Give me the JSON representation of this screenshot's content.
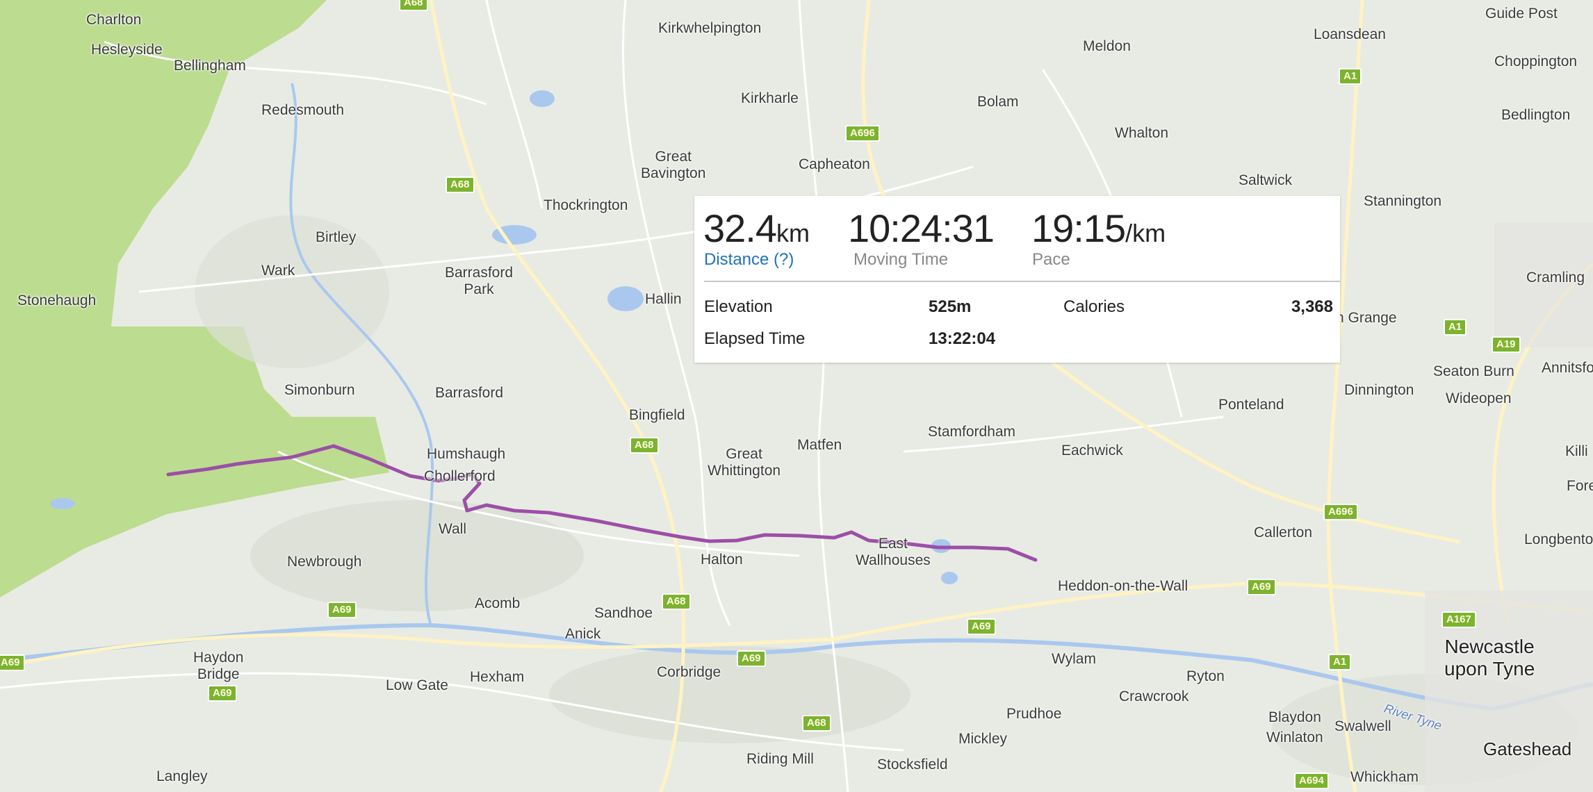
{
  "map": {
    "colors": {
      "land": "#e8ebe3",
      "forest": "#bcdc90",
      "water": "#aac8ee",
      "road": "#ffffff",
      "major_road": "#fde89a",
      "route": "#9b4fa8",
      "shield": "#7cb32f"
    },
    "places": {
      "charlton": "Charlton",
      "hesleyside": "Hesleyside",
      "bellingham": "Bellingham",
      "redesmouth": "Redesmouth",
      "birtley": "Birtley",
      "wark": "Wark",
      "stonehaugh": "Stonehaugh",
      "barrasford_park": "Barrasford\nPark",
      "simonburn": "Simonburn",
      "barrasford": "Barrasford",
      "humshaugh": "Humshaugh",
      "chollerford": "Chollerford",
      "wall": "Wall",
      "newbrough": "Newbrough",
      "acomb": "Acomb",
      "haydon_bridge": "Haydon\nBridge",
      "low_gate": "Low Gate",
      "hexham": "Hexham",
      "langley": "Langley",
      "sandhoe": "Sandhoe",
      "anick": "Anick",
      "corbridge": "Corbridge",
      "riding_mill": "Riding Mill",
      "halton": "Halton",
      "kirkwhelpington": "Kirkwhelpington",
      "kirkharle": "Kirkharle",
      "great_bavington": "Great\nBavington",
      "thockrington": "Thockrington",
      "capheaton": "Capheaton",
      "hallington": "Hallin",
      "bingfield": "Bingfield",
      "great_whittington": "Great\nWhittington",
      "matfen": "Matfen",
      "stamfordham": "Stamfordham",
      "east_wallhouses": "East\nWallhouses",
      "stocksfield": "Stocksfield",
      "mickley": "Mickley",
      "prudhoe": "Prudhoe",
      "wylam": "Wylam",
      "heddon": "Heddon-on-the-Wall",
      "meldon": "Meldon",
      "bolam": "Bolam",
      "whalton": "Whalton",
      "saltwick": "Saltwick",
      "eachwick": "Eachwick",
      "ponteland": "Ponteland",
      "callerton": "Callerton",
      "loansdean": "Loansdean",
      "guide_post": "Guide Post",
      "choppington": "Choppington",
      "bedlington": "Bedlington",
      "stannington": "Stannington",
      "cramling": "Cramling",
      "grange": "n Grange",
      "seaton_burn": "Seaton Burn",
      "annitsford": "Annitsfo",
      "dinnington": "Dinnington",
      "wideopen": "Wideopen",
      "killi": "Killi",
      "fore": "Fore",
      "longbenton": "Longbenton",
      "newcastle": "Newcastle\nupon Tyne",
      "gateshead": "Gateshead",
      "ryton": "Ryton",
      "crawcrook": "Crawcrook",
      "blaydon": "Blaydon",
      "winlaton": "Winlaton",
      "swalwell": "Swalwell",
      "whickham": "Whickham",
      "river_tyne": "River Tyne"
    },
    "shields": {
      "a68_top": "A68",
      "a68_a": "A68",
      "a68_b": "A68",
      "a68_c": "A68",
      "a68_d": "A68",
      "a696_a": "A696",
      "a696_b": "A696",
      "a69_a": "A69",
      "a69_b": "A69",
      "a69_c": "A69",
      "a69_d": "A69",
      "a69_e": "A69",
      "a69_f": "A69",
      "a1_a": "A1",
      "a1_b": "A1",
      "a1_c": "A1",
      "a19": "A19",
      "a167": "A167",
      "a694": "A694"
    }
  },
  "activity": {
    "distance": "32.4",
    "distance_unit": "km",
    "distance_label": "Distance (?)",
    "moving_time": "10:24:31",
    "moving_time_label": "Moving Time",
    "pace": "19:15",
    "pace_unit": "/km",
    "pace_label": "Pace",
    "elevation_label": "Elevation",
    "elevation": "525m",
    "calories_label": "Calories",
    "calories": "3,368",
    "elapsed_time_label": "Elapsed Time",
    "elapsed_time": "13:22:04"
  }
}
